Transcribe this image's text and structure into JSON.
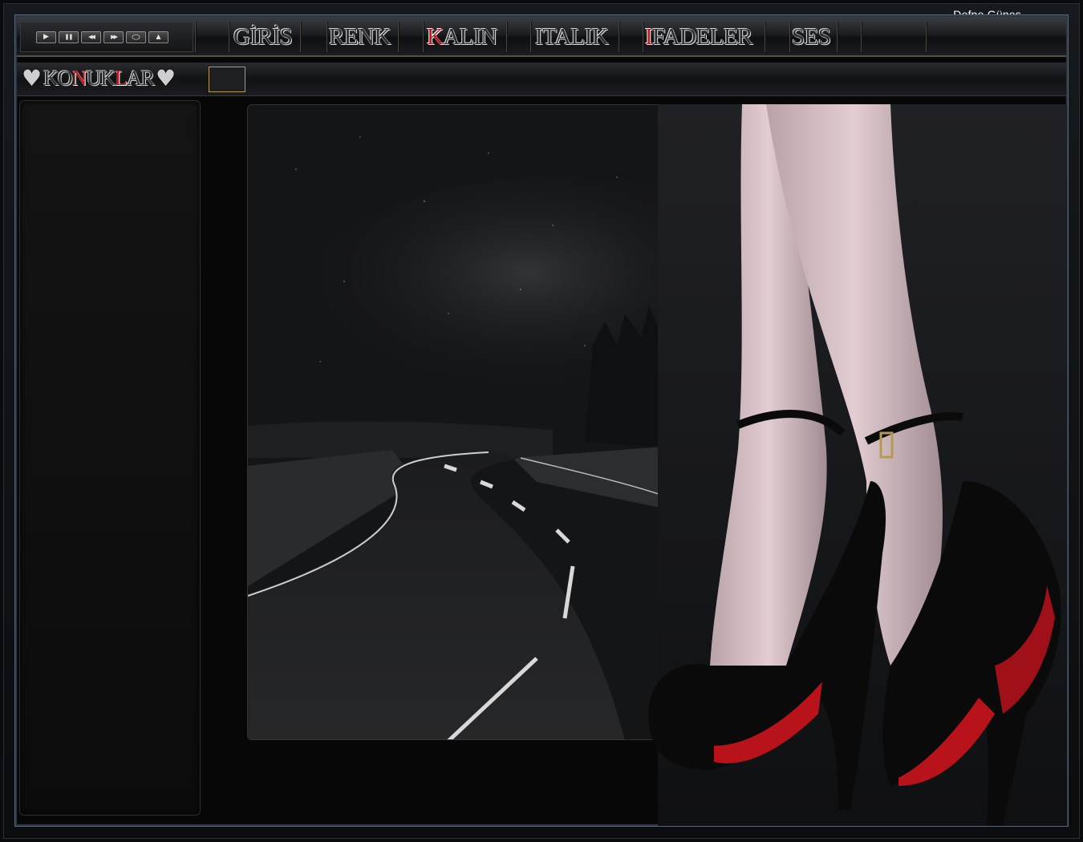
{
  "window": {
    "user_name": "Defne Günes"
  },
  "player": {
    "controls": [
      {
        "name": "play-icon",
        "glyph": "▶"
      },
      {
        "name": "pause-icon",
        "glyph": "❚❚"
      },
      {
        "name": "rewind-icon",
        "glyph": "◀◀"
      },
      {
        "name": "fast-forward-icon",
        "glyph": "▶▶"
      },
      {
        "name": "loop-icon",
        "glyph": "⬭"
      },
      {
        "name": "eject-icon",
        "glyph": "▲"
      }
    ]
  },
  "menu": {
    "items": [
      {
        "id": "giris",
        "first": "G",
        "rest": "İRİS",
        "highlight_first": false
      },
      {
        "id": "renk",
        "first": "R",
        "rest": "ENK",
        "highlight_first": false
      },
      {
        "id": "kalin",
        "first": "K",
        "rest": "ALIN",
        "highlight_first": true
      },
      {
        "id": "italik",
        "first": "I",
        "rest": "TALIK",
        "highlight_first": false
      },
      {
        "id": "ifadeler",
        "first": "I",
        "rest": "FADELER",
        "highlight_first": true
      },
      {
        "id": "ses",
        "first": "S",
        "rest": "ES",
        "highlight_first": false
      }
    ]
  },
  "guests": {
    "tab_parts": [
      "KO",
      "N",
      "UK",
      "L",
      "AR"
    ]
  },
  "colors": {
    "accent_red": "#c4141a",
    "frame_border": "#2b3644",
    "input_border": "#b59a54"
  }
}
